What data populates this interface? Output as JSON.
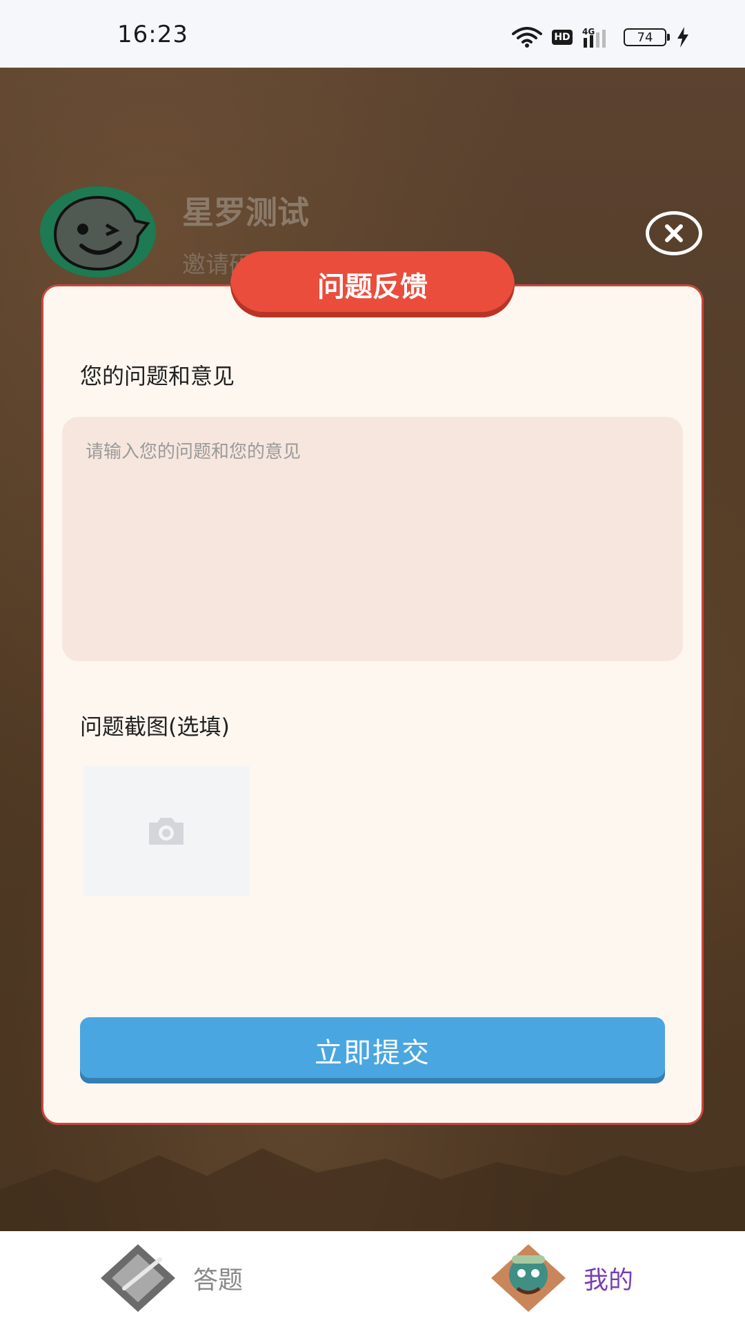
{
  "status_bar": {
    "time": "16:23",
    "hd": "HD",
    "network": "4G",
    "battery": "74"
  },
  "profile": {
    "name": "星罗测试",
    "subtitle": "邀请码"
  },
  "modal": {
    "title": "问题反馈",
    "question_label": "您的问题和意见",
    "question_placeholder": "请输入您的问题和您的意见",
    "screenshot_label": "问题截图(选填)",
    "submit_label": "立即提交"
  },
  "bottom_nav": {
    "items": [
      {
        "label": "答题",
        "active": false,
        "color": "#888888"
      },
      {
        "label": "我的",
        "active": true,
        "color": "#7a3fb0"
      }
    ]
  },
  "colors": {
    "title_pill": "#ea4d3c",
    "submit": "#4aa6e0",
    "modal_border": "#c9463d",
    "textarea_bg": "#f6e6de"
  },
  "icons": {
    "close": "close-icon",
    "camera": "camera-icon",
    "wifi": "wifi-icon",
    "signal": "signal-icon",
    "battery": "battery-icon",
    "charging": "charging-icon"
  }
}
